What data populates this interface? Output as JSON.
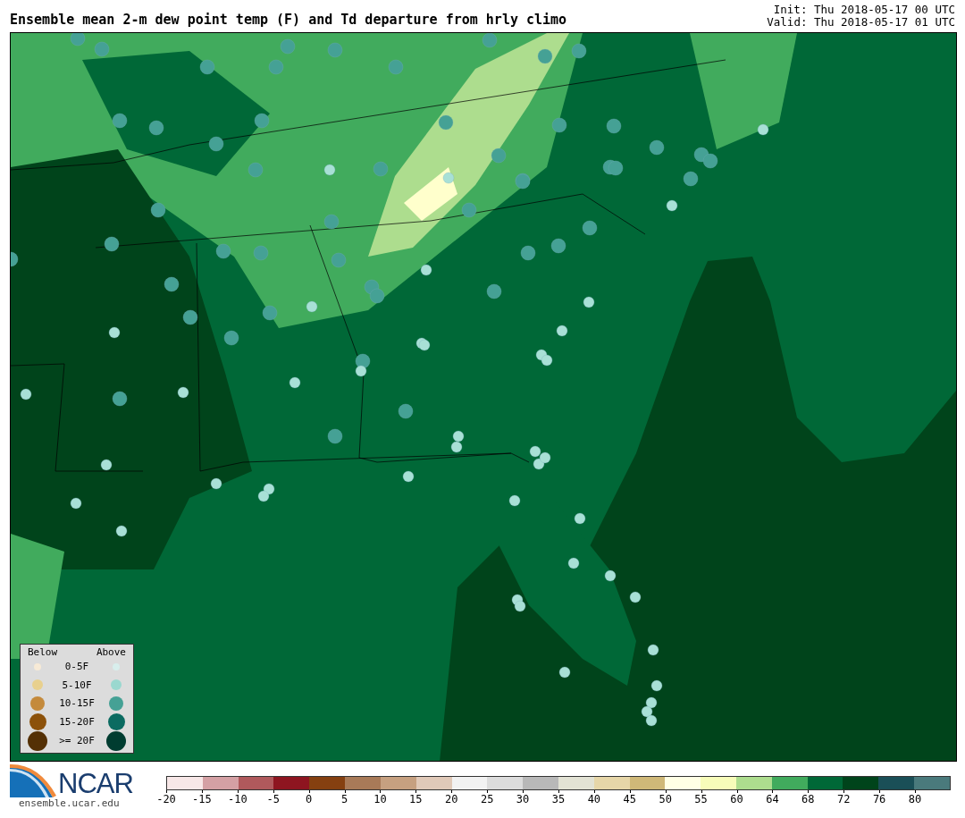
{
  "title": "Ensemble mean 2-m dew point temp (F) and Td departure from hrly climo",
  "init": "Init: Thu 2018-05-17 00 UTC",
  "valid": "Valid: Thu 2018-05-17 01 UTC",
  "legend": {
    "below_header": "Below",
    "above_header": "Above",
    "rows": [
      {
        "label": "0-5F",
        "below": {
          "color": "#f7ead6"
        },
        "above": {
          "color": "#d8eeec"
        }
      },
      {
        "label": "5-10F",
        "below": {
          "color": "#e8d08e"
        },
        "above": {
          "color": "#9ad8cf"
        }
      },
      {
        "label": "10-15F",
        "below": {
          "color": "#c48a3c"
        },
        "above": {
          "color": "#45a195"
        }
      },
      {
        "label": "15-20F",
        "below": {
          "color": "#8c510a"
        },
        "above": {
          "color": "#0b6b61"
        }
      },
      {
        "label": ">= 20F",
        "below": {
          "color": "#543005"
        },
        "above": {
          "color": "#003c30"
        }
      }
    ]
  },
  "logo": {
    "text": "NCAR",
    "url": "ensemble.ucar.edu"
  },
  "colorbar": {
    "segments": [
      {
        "color": "#f7e7e7"
      },
      {
        "color": "#d4a0a4"
      },
      {
        "color": "#b0595c"
      },
      {
        "color": "#8e1520"
      },
      {
        "color": "#854010"
      },
      {
        "color": "#a87a58"
      },
      {
        "color": "#c6a080"
      },
      {
        "color": "#e0c9b8"
      },
      {
        "color": "#f2f2f2"
      },
      {
        "color": "#dcdcdc"
      },
      {
        "color": "#b8b8b8"
      },
      {
        "color": "#e2e2d4"
      },
      {
        "color": "#e6d6a8"
      },
      {
        "color": "#cfb878"
      },
      {
        "color": "#ffffe5"
      },
      {
        "color": "#f7fcb9"
      },
      {
        "color": "#addd8e"
      },
      {
        "color": "#41ab5d"
      },
      {
        "color": "#006837"
      },
      {
        "color": "#00441b"
      },
      {
        "color": "#1a4f57"
      },
      {
        "color": "#4a7a7c"
      }
    ],
    "ticks": [
      "-20",
      "-15",
      "-10",
      "-5",
      "0",
      "5",
      "10",
      "15",
      "20",
      "25",
      "30",
      "35",
      "40",
      "45",
      "50",
      "55",
      "60",
      "64",
      "68",
      "72",
      "76",
      "80"
    ]
  }
}
